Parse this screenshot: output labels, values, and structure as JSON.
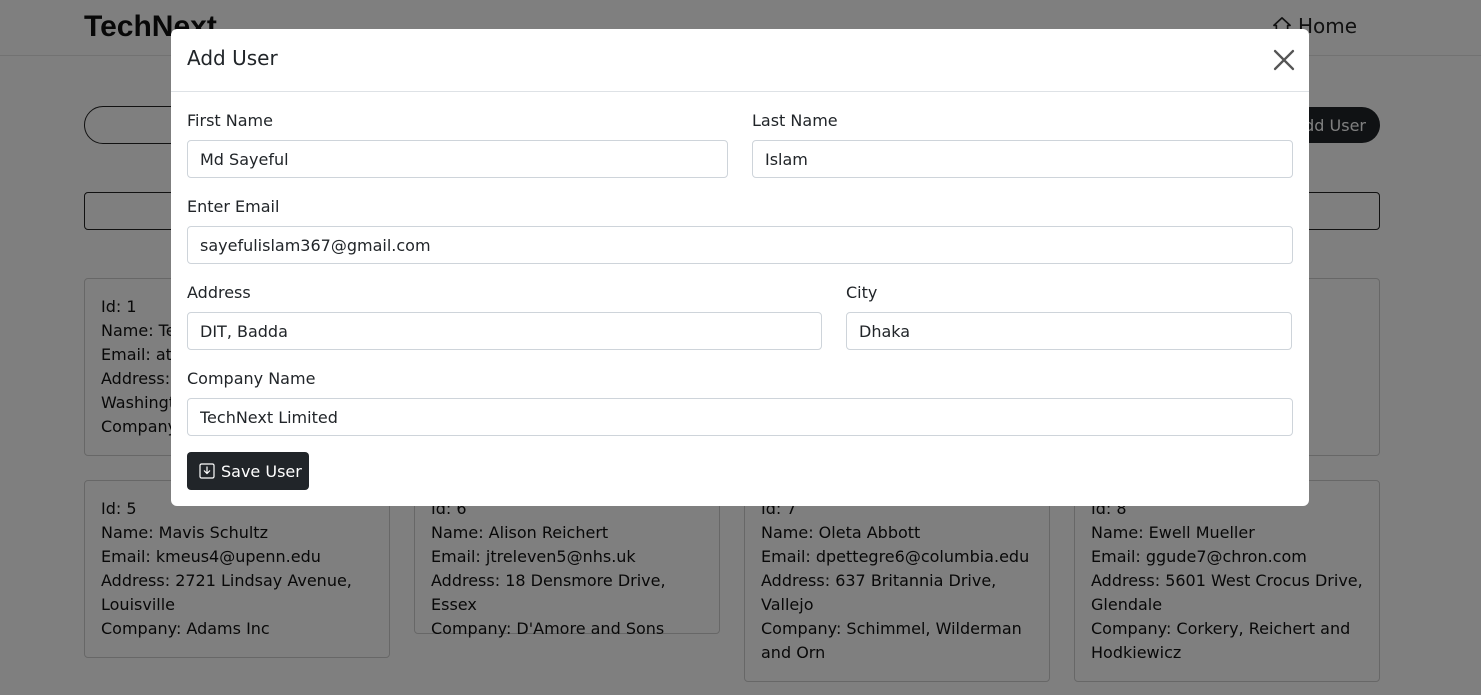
{
  "navbar": {
    "brand": "TechNext",
    "home_label": "Home"
  },
  "toolbar": {
    "add_user_label": "Add User"
  },
  "users": [
    {
      "id": "Id: 1",
      "name": "Name: Te",
      "email": "Email: atu",
      "address": "Address:",
      "address2": "Washingt",
      "company": "Company"
    },
    {
      "id": "Id: 5",
      "name": "Name: Mavis Schultz",
      "email": "Email: kmeus4@upenn.edu",
      "address": "Address: 2721 Lindsay Avenue,",
      "address2": "Louisville",
      "company": "Company: Adams Inc"
    },
    {
      "id": "Id: 6",
      "name": "Name: Alison Reichert",
      "email": "Email: jtreleven5@nhs.uk",
      "address": "Address: 18 Densmore Drive, Essex",
      "company": "Company: D'Amore and Sons"
    },
    {
      "id": "Id: 7",
      "name": "Name: Oleta Abbott",
      "email": "Email: dpettegre6@columbia.edu",
      "address": "Address: 637 Britannia Drive,",
      "address2": "Vallejo",
      "company": "Company: Schimmel, Wilderman",
      "company2": "and Orn"
    },
    {
      "id": "Id: 8",
      "name": "Name: Ewell Mueller",
      "email": "Email: ggude7@chron.com",
      "address": "Address: 5601 West Crocus Drive,",
      "address2": "Glendale",
      "company": "Company: Corkery, Reichert and",
      "company2": "Hodkiewicz"
    }
  ],
  "modal": {
    "title": "Add User",
    "first_name_label": "First Name",
    "first_name_value": "Md Sayeful",
    "last_name_label": "Last Name",
    "last_name_value": "Islam",
    "email_label": "Enter Email",
    "email_value": "sayefulislam367@gmail.com",
    "address_label": "Address",
    "address_value": "DIT, Badda",
    "city_label": "City",
    "city_value": "Dhaka",
    "company_label": "Company Name",
    "company_value": "TechNext Limited",
    "save_label": "Save User"
  }
}
